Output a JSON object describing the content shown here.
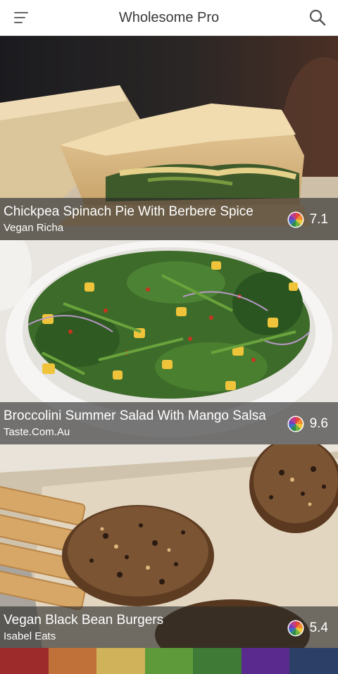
{
  "header": {
    "title": "Wholesome Pro",
    "menu_icon": "hamburger-menu-icon",
    "search_icon": "search-icon"
  },
  "recipes": [
    {
      "name": "Chickpea Spinach Pie With Berbere Spice",
      "source": "Vegan Richa",
      "score": "7.1"
    },
    {
      "name": "Broccolini Summer Salad With Mango Salsa",
      "source": "Taste.Com.Au",
      "score": "9.6"
    },
    {
      "name": "Vegan Black Bean Burgers",
      "source": "Isabel Eats",
      "score": "5.4"
    }
  ],
  "score_icon": "nutrient-wheel-icon",
  "palette_colors": [
    "#9e2b2b",
    "#c0713a",
    "#cfb25a",
    "#5f9a3a",
    "#3f7a37",
    "#5a2a8e",
    "#2c3f66"
  ]
}
